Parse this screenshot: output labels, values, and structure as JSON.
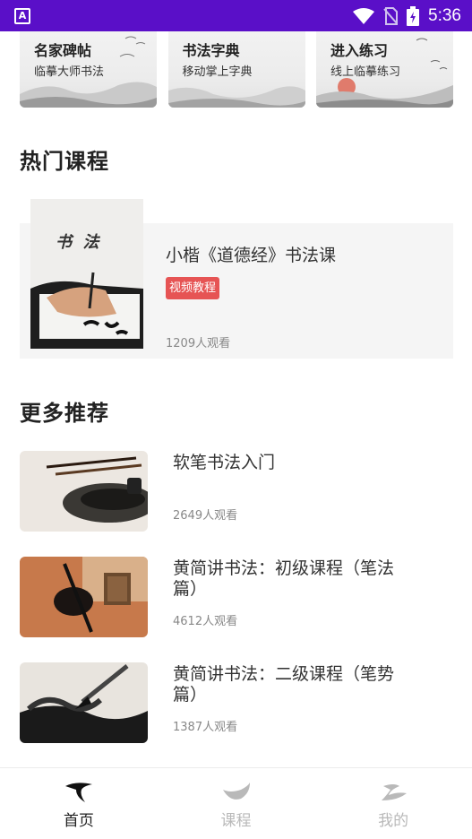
{
  "status_bar": {
    "app_icon_letter": "A",
    "time": "5:36"
  },
  "top_cards": [
    {
      "title": "名家碑帖",
      "subtitle": "临摹大师书法"
    },
    {
      "title": "书法字典",
      "subtitle": "移动掌上字典"
    },
    {
      "title": "进入练习",
      "subtitle": "线上临摹练习"
    }
  ],
  "hot_section": {
    "title": "热门课程",
    "course": {
      "cover_text": "书  法",
      "title": "小楷《道德经》书法课",
      "tag": "视频教程",
      "views": "1209人观看"
    }
  },
  "more_section": {
    "title": "更多推荐",
    "items": [
      {
        "title": "软笔书法入门",
        "views": "2649人观看"
      },
      {
        "title": "黄简讲书法：初级课程（笔法篇）",
        "views": "4612人观看"
      },
      {
        "title": "黄简讲书法：二级课程（笔势篇）",
        "views": "1387人观看"
      }
    ]
  },
  "bottom_nav": {
    "items": [
      {
        "label": "首页",
        "icon": "home-brush-icon",
        "active": true
      },
      {
        "label": "课程",
        "icon": "course-brush-icon",
        "active": false
      },
      {
        "label": "我的",
        "icon": "profile-brush-icon",
        "active": false
      }
    ]
  },
  "colors": {
    "status_bar": "#5a0fc8",
    "tag": "#e65454",
    "muted_text": "#888888",
    "inactive_nav": "#b9b9b9"
  }
}
